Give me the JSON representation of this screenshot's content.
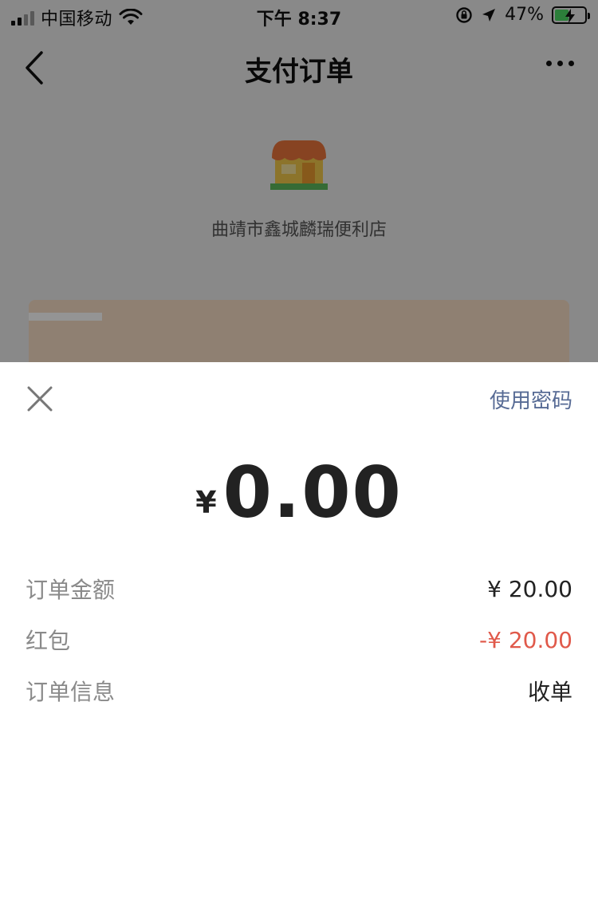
{
  "status_bar": {
    "carrier": "中国移动",
    "time": "下午 8:37",
    "battery_percent": "47%",
    "battery_level": 0.47,
    "icons": [
      "signal-icon",
      "wifi-icon",
      "rotation-lock-icon",
      "location-icon",
      "battery-icon"
    ]
  },
  "nav": {
    "title": "支付订单",
    "back_icon": "chevron-left-icon",
    "more_icon": "more-dots-icon"
  },
  "background": {
    "shop_icon": "store-icon",
    "shop_name": "曲靖市鑫城麟瑞便利店"
  },
  "sheet": {
    "close_icon": "close-icon",
    "use_password": "使用密码",
    "currency_symbol": "¥",
    "amount": "0.00",
    "rows": [
      {
        "label": "订单金额",
        "value": "¥ 20.00"
      },
      {
        "label": "红包",
        "value": "-¥ 20.00"
      },
      {
        "label": "订单信息",
        "value": "收单"
      }
    ]
  },
  "colors": {
    "link": "#576b95",
    "discount_red": "#e0594a",
    "battery_green": "#4cd964",
    "overlay": "rgba(0,0,0,0.42)"
  }
}
